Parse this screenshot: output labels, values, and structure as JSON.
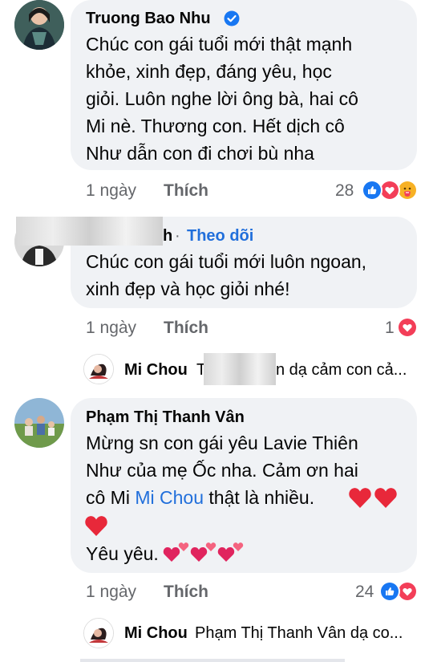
{
  "comments": [
    {
      "author": "Truong Bao Nhu",
      "verified": true,
      "lines": [
        "Chúc con gái tuổi mới thật mạnh",
        "khỏe, xinh đẹp, đáng yêu, học",
        "giỏi. Luôn nghe lời ông bà, hai cô",
        "Mi nè. Thương con. Hết dịch cô",
        "Như dẫn con đi chơi bù nha"
      ],
      "time": "1 ngày",
      "like_label": "Thích",
      "reaction_count": "28",
      "reactions": [
        "like-icon",
        "love-icon",
        "care-icon"
      ]
    },
    {
      "author_suffix": "h",
      "follow_label": "Theo dõi",
      "lines": [
        "Chúc con gái tuổi mới luôn ngoan,",
        "xinh đẹp và học giỏi nhé!"
      ],
      "time": "1 ngày",
      "like_label": "Thích",
      "reaction_count": "1",
      "reactions": [
        "love-icon"
      ],
      "reply": {
        "name": "Mi Chou",
        "name_suffix": "T",
        "text": "n dạ cảm con cả..."
      }
    },
    {
      "author": "Phạm Thị Thanh Vân",
      "lines": [
        "Mừng sn con gái yêu Lavie Thiên",
        "Như của mẹ Ốc nha. Cảm ơn hai"
      ],
      "line3_prefix": "cô Mi ",
      "line3_link": "Mi Chou",
      "line3_suffix": " thật là nhiều.",
      "line5": "Yêu yêu.",
      "time": "1 ngày",
      "like_label": "Thích",
      "reaction_count": "24",
      "reactions": [
        "like-icon",
        "love-icon"
      ],
      "reply": {
        "name": "Mi Chou",
        "text": "Phạm Thị Thanh Vân dạ co..."
      }
    }
  ],
  "colors": {
    "like": "#1877f2",
    "love": "#f33e58",
    "care": "#f7b125",
    "bubble": "#f0f2f5",
    "meta": "#65676b",
    "link": "#216fdb"
  }
}
